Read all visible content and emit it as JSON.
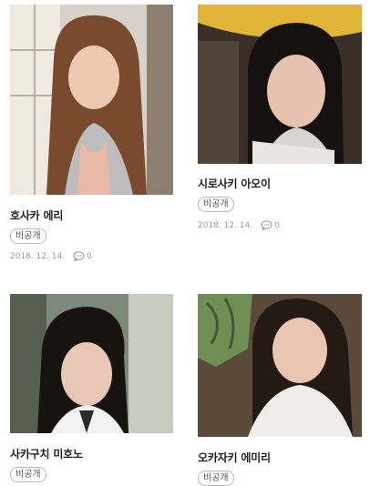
{
  "posts": [
    {
      "title": "호사카 에리",
      "badge": "비공개",
      "date": "2018. 12. 14.",
      "comments": "0"
    },
    {
      "title": "시로사키 아오이",
      "badge": "비공개",
      "date": "2018. 12. 14.",
      "comments": "0"
    },
    {
      "title": "사카구치 미호노",
      "badge": "비공개"
    },
    {
      "title": "오카자키 에미리",
      "badge": "비공개"
    }
  ],
  "icons": {
    "comment": "comment-bubble-icon"
  }
}
